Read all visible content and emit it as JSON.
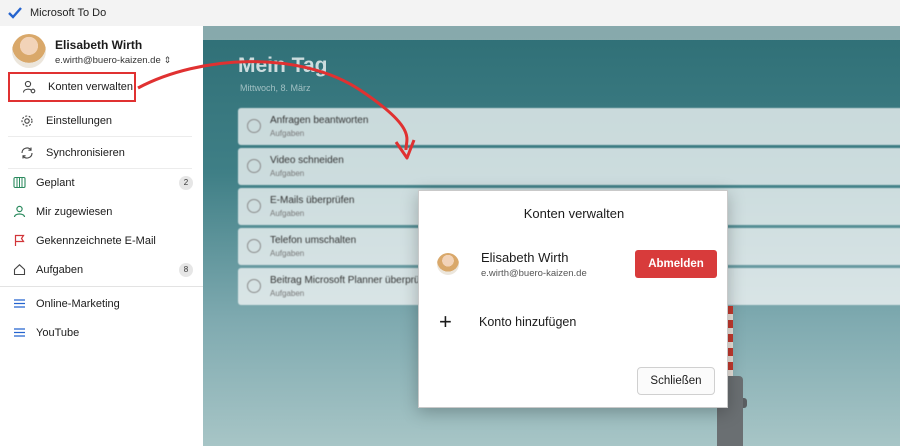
{
  "app": {
    "title": "Microsoft To Do"
  },
  "profile": {
    "name": "Elisabeth Wirth",
    "email": "e.wirth@buero-kaizen.de"
  },
  "account_menu": {
    "items": [
      {
        "label": "Konten verwalten",
        "icon": "person-gear-icon"
      },
      {
        "label": "Einstellungen",
        "icon": "gear-icon"
      },
      {
        "label": "Synchronisieren",
        "icon": "sync-icon"
      }
    ]
  },
  "nav": {
    "items": [
      {
        "label": "Geplant",
        "icon": "calendar-icon",
        "count": "2"
      },
      {
        "label": "Mir zugewiesen",
        "icon": "person-icon"
      },
      {
        "label": "Gekennzeichnete E-Mail",
        "icon": "flag-icon"
      },
      {
        "label": "Aufgaben",
        "icon": "home-icon",
        "count": "8"
      }
    ],
    "lists": [
      {
        "label": "Online-Marketing",
        "icon": "list-icon"
      },
      {
        "label": "YouTube",
        "icon": "list-icon"
      }
    ]
  },
  "main": {
    "title": "Mein Tag",
    "date": "Mittwoch, 8. März",
    "tasks": [
      {
        "title": "Anfragen beantworten",
        "sub": "Aufgaben"
      },
      {
        "title": "Video schneiden",
        "sub": "Aufgaben"
      },
      {
        "title": "E-Mails überprüfen",
        "sub": "Aufgaben"
      },
      {
        "title": "Telefon umschalten",
        "sub": "Aufgaben"
      },
      {
        "title": "Beitrag Microsoft Planner überprüfen",
        "sub": "Aufgaben"
      }
    ]
  },
  "dialog": {
    "title": "Konten verwalten",
    "account_name": "Elisabeth Wirth",
    "account_email": "e.wirth@buero-kaizen.de",
    "signout_label": "Abmelden",
    "add_account_label": "Konto hinzufügen",
    "close_label": "Schließen"
  },
  "colors": {
    "accent_red": "#d83b3b",
    "highlight_red": "#e03131",
    "app_blue": "#2564cf"
  }
}
